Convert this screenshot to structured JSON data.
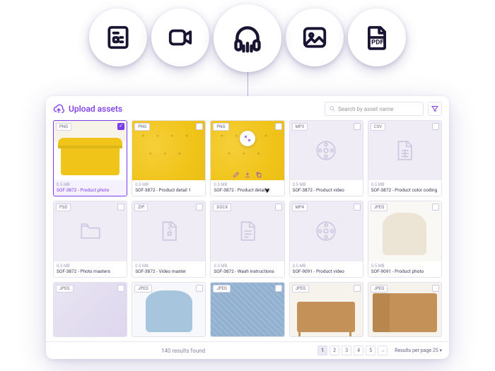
{
  "type_bubbles": [
    "document-icon",
    "video-icon",
    "audio-icon",
    "image-icon",
    "pdf-icon"
  ],
  "header": {
    "title": "Upload assets",
    "search_placeholder": "Search by asset name"
  },
  "assets": [
    {
      "format": "PNG",
      "size": "0.5 MB",
      "name": "SOF-3872 - Product photo",
      "thumb": "sofa-yellow",
      "selected": true
    },
    {
      "format": "PNG",
      "size": "0.5 MB",
      "name": "SOF-3872 - Product detail 1",
      "thumb": "sofa-yellow-detail",
      "selected": false
    },
    {
      "format": "PNG",
      "size": "0.5 MB",
      "name": "SOF-3872 - Product detail 2",
      "thumb": "sofa-yellow-detail",
      "selected": false,
      "hovered": true
    },
    {
      "format": "MP3",
      "size": "0.5 MB",
      "name": "SOF-3872 - Product video",
      "thumb": "reel",
      "selected": false
    },
    {
      "format": "CSV",
      "size": "0.5 MB",
      "name": "SOF-3872 - Product color coding",
      "thumb": "sheet",
      "selected": false
    },
    {
      "format": "PSD",
      "size": "0.5 MB",
      "name": "SOF-3872 - Photo masters",
      "thumb": "folder",
      "selected": false
    },
    {
      "format": "ZIP",
      "size": "0.5 MB",
      "name": "SOF-3872 - Video master",
      "thumb": "zip",
      "selected": false
    },
    {
      "format": "DOCX",
      "size": "0.5 MB",
      "name": "SOF-3872 - Wash instructions",
      "thumb": "doc",
      "selected": false
    },
    {
      "format": "MP4",
      "size": "0.5 MB",
      "name": "SOF-9091 - Product video",
      "thumb": "reel",
      "selected": false
    },
    {
      "format": "JPEG",
      "size": "0.5 MB",
      "name": "SOF-9091 - Product photo",
      "thumb": "chair-beige",
      "selected": false
    },
    {
      "format": "JPEG",
      "size": "",
      "name": "",
      "thumb": "jpeg-placeholder",
      "selected": false
    },
    {
      "format": "JPEG",
      "size": "",
      "name": "",
      "thumb": "chair-blue",
      "selected": false
    },
    {
      "format": "JPEG",
      "size": "",
      "name": "",
      "thumb": "fabric-blue",
      "selected": false
    },
    {
      "format": "JPEG",
      "size": "",
      "name": "",
      "thumb": "wood-shelf",
      "selected": false
    },
    {
      "format": "JPEG",
      "size": "",
      "name": "",
      "thumb": "wood-cabinet",
      "selected": false
    }
  ],
  "footer": {
    "results_text": "140 results found",
    "pages": [
      "1",
      "2",
      "3",
      "4",
      "5"
    ],
    "active_page": 0,
    "next_icon": "→",
    "rpp_label": "Results per page",
    "rpp_value": "25"
  }
}
